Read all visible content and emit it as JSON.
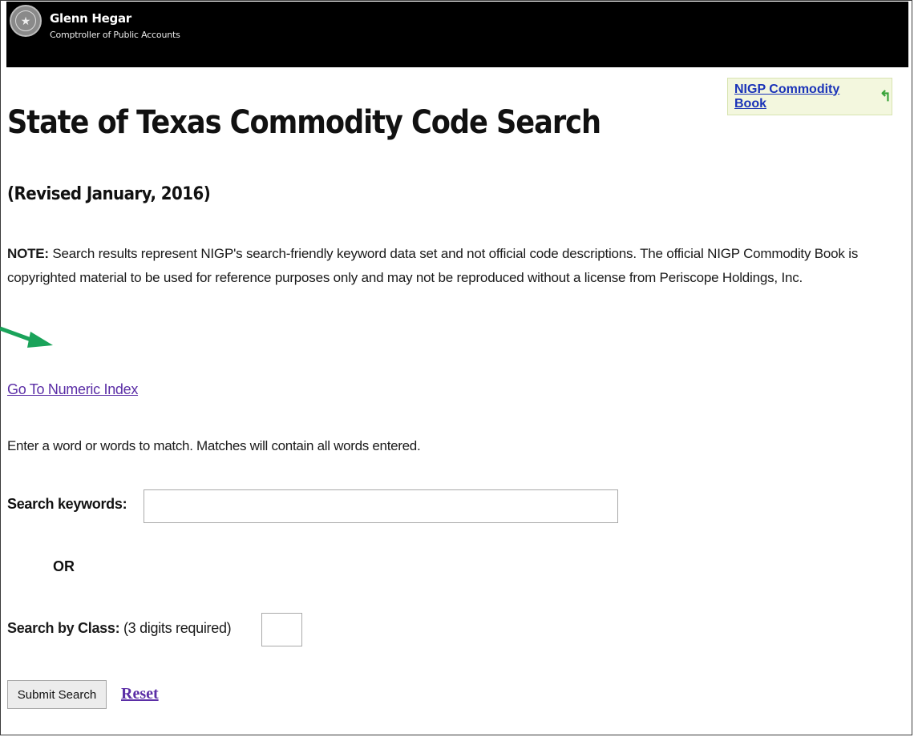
{
  "header": {
    "name": "Glenn Hegar",
    "office": "Comptroller of Public Accounts",
    "seal_icon": "state-seal-icon"
  },
  "book_link": {
    "label": "NIGP Commodity Book",
    "icon": "return-arrow-icon"
  },
  "page": {
    "title": "State of Texas Commodity Code Search",
    "revised": "(Revised January, 2016)"
  },
  "note": {
    "label": "NOTE:",
    "text": " Search results represent NIGP's search-friendly keyword data set and not official code descriptions. The official NIGP Commodity Book is copyrighted material to be used for reference purposes only and may not be reproduced without a license from Periscope Holdings, Inc."
  },
  "links": {
    "numeric_index": "Go To Numeric Index"
  },
  "instructions": "Enter a word or words to match. Matches will contain all words entered.",
  "search": {
    "keywords_label": "Search keywords:",
    "keywords_value": "",
    "or_label": "OR",
    "class_label": "Search by Class:",
    "class_hint": " (3 digits required)",
    "class_value": ""
  },
  "actions": {
    "submit_label": "Submit Search",
    "reset_label": "Reset"
  },
  "colors": {
    "header_bg": "#000000",
    "link_blue": "#1a33b8",
    "visited_link": "#5b2ea6",
    "book_box_bg": "#f3f7de",
    "pointer_arrow": "#1aa35a"
  }
}
